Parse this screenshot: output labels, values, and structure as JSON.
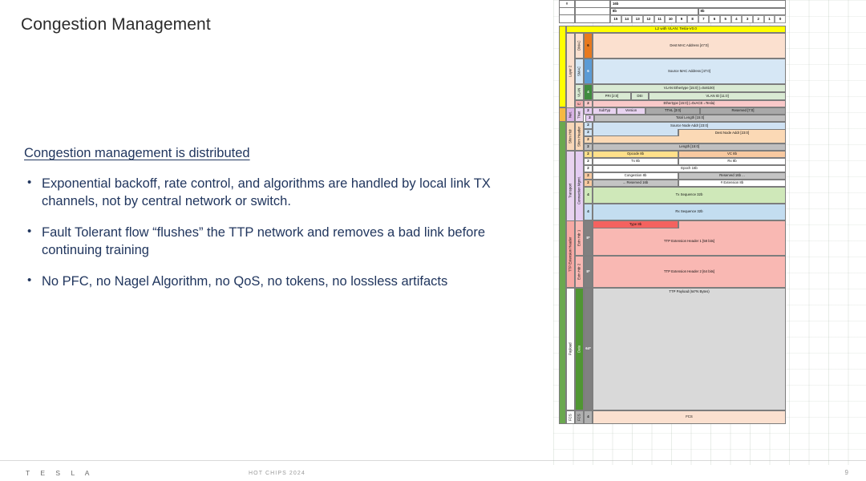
{
  "slide": {
    "title": "Congestion Management",
    "lead": "Congestion management is distributed",
    "bullets": [
      "Exponential backoff, rate control, and algorithms are handled by local link TX channels, not by central network or switch.",
      "Fault Tolerant flow “flushes” the TTP network and removes a bad link before continuing training",
      "No PFC, no Nagel Algorithm, no QoS, no tokens, no lossless artifacts"
    ]
  },
  "footer": {
    "brand": "T E S L A",
    "center": "HOT CHIPS 2024",
    "page": "9"
  },
  "packet": {
    "corner": "#",
    "width_16b": "16b",
    "width_8b_hi": "8b",
    "width_8b_lo": "8b",
    "bits": [
      "15",
      "14",
      "13",
      "12",
      "11",
      "10",
      "9",
      "8",
      "7",
      "6",
      "5",
      "4",
      "3",
      "2",
      "1",
      "0"
    ],
    "banner": "L2 with VLAN:  Tesla-V0.0",
    "groups": {
      "layer2": "Layer 2",
      "net": "Net.",
      "shim_hdr": "Shim Hdr",
      "transport": "Transport",
      "ttp_ext_header": "TTP Extension Header",
      "payload": "Payload",
      "fcs": "FCS"
    },
    "subgroups": {
      "dmac": "DMAC",
      "smac": "SMAC",
      "vlan": "VLAN",
      "ethertype": "E",
      "tnet": "TNet",
      "shim_header": "Shim Header",
      "conn_mgmt": "Connection Mgmt.",
      "extn_hdr_1": "Extn Hdr 1",
      "extn_hdr_2": "Extn Hdr 2",
      "data": "Data",
      "fcs": "FCS"
    },
    "sizes": {
      "dmac": "6",
      "smac": "6",
      "vlan": "4",
      "ethertype": "2",
      "tnet_a": "2",
      "tnet_b": "2",
      "shim_a": "2",
      "shim_b": "2",
      "shim_c": "2",
      "shim_len": "2",
      "tr_opcode": "2",
      "tr_txrx": "2",
      "tr_epoch": "2",
      "tr_cong": "2",
      "tr_rsvd": "2",
      "tx_seq": "4",
      "rx_seq": "4",
      "ext1": "8*",
      "ext2": "8*",
      "payload": "64*",
      "fcs": "4"
    },
    "fields": {
      "dest_mac": "Dest MAC Address [47:0]",
      "source_mac": "Source MAC Address [47:0]",
      "vlan_ethertype": "VLAN Ethertype [15:0] (=0x8100)",
      "pri": "PRI [2:0]",
      "dei": "DEI",
      "vlan_id": "VLAN ID [11:0]",
      "ethertype": "Ethertype [15:0] (=0xACE =Tesla)",
      "subtyp": "SubTyp",
      "version": "Version",
      "tthl": "TTHL [3:0]",
      "reserved_7_0": "Reserved [7:0]",
      "total_length": "Total Length [15:0]",
      "source_node_addr": "Source Node Addr [23:0]",
      "dest_node_addr": "Dest Node Addr  [23:0]",
      "length": "Length [15:0]",
      "opcode": "Opcode 8b",
      "vc": "VC 8b",
      "tx8": "Tx 8b",
      "rx8": "Rx 8b",
      "epoch": "Epoch 16b",
      "congestion": "Congestion 8b",
      "reserved16_hi": "Reserved 16b ...",
      "reserved16_lo": "... Reserved 16b",
      "num_extension": "# Extension 8b",
      "tx_sequence": "Tx Sequence 32b",
      "rx_sequence": "Rx Sequence 32b",
      "type8": "Type 8b",
      "ext_header_1": "TTP Extension Header 1 [58 bits]",
      "ext_header_2": "TTP Extension Header 2 [64 bits]",
      "ttp_payload": "TTP Payload (64*N Bytes)",
      "fcs": "FCS"
    }
  }
}
